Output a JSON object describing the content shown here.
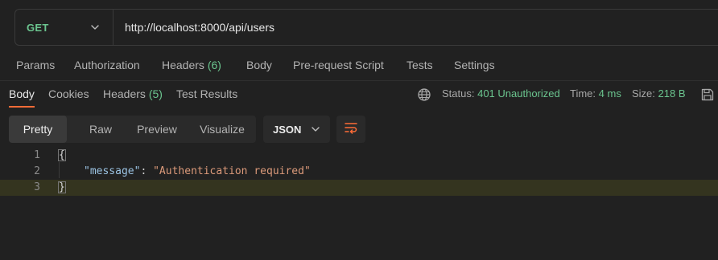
{
  "request": {
    "method": "GET",
    "url": "http://localhost:8000/api/users"
  },
  "request_tabs": {
    "params": "Params",
    "authorization": "Authorization",
    "headers_label": "Headers",
    "headers_count": "(6)",
    "body": "Body",
    "prerequest": "Pre-request Script",
    "tests": "Tests",
    "settings": "Settings"
  },
  "response_tabs": {
    "body": "Body",
    "cookies": "Cookies",
    "headers_label": "Headers",
    "headers_count": "(5)",
    "test_results": "Test Results"
  },
  "status": {
    "status_label": "Status:",
    "status_value": "401 Unauthorized",
    "time_label": "Time:",
    "time_value": "4 ms",
    "size_label": "Size:",
    "size_value": "218 B"
  },
  "view": {
    "pretty": "Pretty",
    "raw": "Raw",
    "preview": "Preview",
    "visualize": "Visualize",
    "format": "JSON"
  },
  "code": {
    "line_numbers": [
      "1",
      "2",
      "3"
    ],
    "open_brace": "{",
    "key": "\"message\"",
    "colon": ": ",
    "value": "\"Authentication required\"",
    "close_brace": "}"
  },
  "colors": {
    "accent": "#ff6c37",
    "success": "#6bc58f",
    "background": "#212121"
  },
  "icons": [
    "chevron-down-icon",
    "globe-icon",
    "save-icon",
    "wrap-lines-icon"
  ]
}
